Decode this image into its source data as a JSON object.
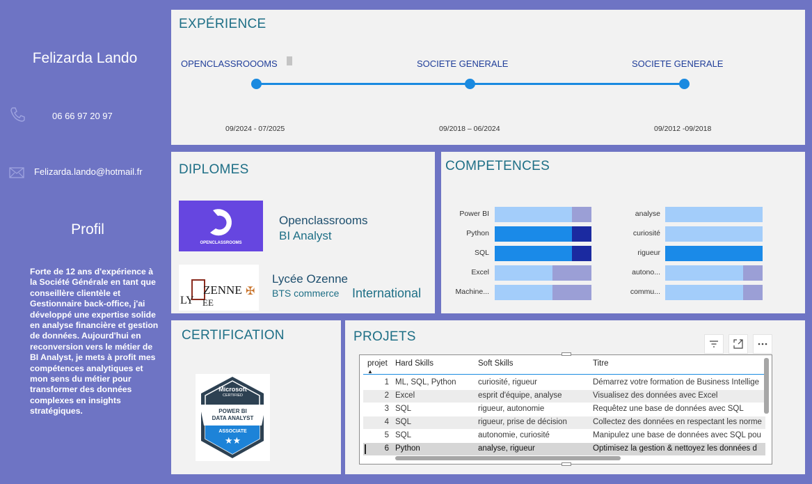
{
  "profile": {
    "name": "Felizarda Lando",
    "phone": "06 66 97 20 97",
    "email": "Felizarda.lando@hotmail.fr",
    "profil_title": "Profil",
    "profil_text": "Forte de 12 ans d'expérience à la Société Générale en  tant que conseillère clientèle et Gestionnaire back-office, j'ai développé une expertise solide en analyse financière et gestion de données. Aujourd'hui en reconversion vers le métier de BI Analyst, je mets à profit mes compétences analytiques et mon sens du métier pour transformer des données complexes en insights stratégiques."
  },
  "experience": {
    "title": "EXPÉRIENCE",
    "items": [
      {
        "company": "OPENCLASSROOOMS",
        "dates": "09/2024 - 07/2025"
      },
      {
        "company": "SOCIETE GENERALE",
        "dates": "09/2018 – 06/2024"
      },
      {
        "company": "SOCIETE GENERALE",
        "dates": "09/2012 -09/2018"
      }
    ]
  },
  "diplomes": {
    "title": "DIPLOMES",
    "items": [
      {
        "school": "Openclassrooms",
        "degree": "BI Analyst",
        "logo_text": "OPENCLASSROOMS"
      },
      {
        "school": "Lycée Ozenne",
        "degree_a": "BTS commerce",
        "degree_b": "International",
        "logo_text_a": "ZENNE",
        "logo_text_b": "LY",
        "logo_text_c": "EE"
      }
    ]
  },
  "competences": {
    "title": "COMPETENCES",
    "hard": [
      {
        "label": "Power BI",
        "level": 0.8,
        "colors": [
          "#a3cdfa",
          "#9b9fd6"
        ]
      },
      {
        "label": "Python",
        "level": 0.8,
        "colors": [
          "#1a8ae8",
          "#1b2aa0"
        ]
      },
      {
        "label": "SQL",
        "level": 0.8,
        "colors": [
          "#1a8ae8",
          "#1b2aa0"
        ]
      },
      {
        "label": "Excel",
        "level": 0.6,
        "colors": [
          "#a3cdfa",
          "#9b9fd6"
        ]
      },
      {
        "label": "Machine...",
        "level": 0.6,
        "colors": [
          "#a3cdfa",
          "#9b9fd6"
        ]
      }
    ],
    "soft": [
      {
        "label": "analyse",
        "level": 1.0,
        "colors": [
          "#a3cdfa",
          "#9b9fd6"
        ]
      },
      {
        "label": "curiosité",
        "level": 1.0,
        "colors": [
          "#a3cdfa",
          "#9b9fd6"
        ]
      },
      {
        "label": "rigueur",
        "level": 1.0,
        "colors": [
          "#1a8ae8",
          "#1b2aa0"
        ]
      },
      {
        "label": "autono...",
        "level": 0.8,
        "colors": [
          "#a3cdfa",
          "#9b9fd6"
        ]
      },
      {
        "label": "commu...",
        "level": 0.8,
        "colors": [
          "#a3cdfa",
          "#9b9fd6"
        ]
      }
    ]
  },
  "certification": {
    "title": "CERTIFICATION",
    "badge_brand": "Microsoft",
    "badge_sub": "CERTIFIED",
    "badge_line1": "POWER BI",
    "badge_line2": "DATA ANALYST",
    "badge_level": "ASSOCIATE",
    "badge_stars": "★★"
  },
  "projets": {
    "title": "PROJETS",
    "columns": [
      "projet",
      "Hard Skills",
      "Soft Skills",
      "Titre"
    ],
    "rows": [
      {
        "n": "1",
        "hard": "ML, SQL, Python",
        "soft": "curiosité, rigueur",
        "titre": "Démarrez votre formation de Business Intellige"
      },
      {
        "n": "2",
        "hard": "Excel",
        "soft": "esprit d'équipe, analyse",
        "titre": "Visualisez des données avec Excel"
      },
      {
        "n": "3",
        "hard": "SQL",
        "soft": "rigueur, autonomie",
        "titre": "Requêtez une base de données avec SQL"
      },
      {
        "n": "4",
        "hard": "SQL",
        "soft": "rigueur, prise de décision",
        "titre": "Collectez des données en respectant les norme"
      },
      {
        "n": "5",
        "hard": "SQL",
        "soft": "autonomie, curiosité",
        "titre": "Manipulez une base de données avec SQL pou"
      },
      {
        "n": "6",
        "hard": "Python",
        "soft": "analyse, rigueur",
        "titre": "Optimisez la gestion & nettoyez les données d"
      }
    ]
  },
  "icons": {
    "phone": "phone-icon",
    "email": "mail-icon",
    "filter": "filter-icon",
    "focus": "focus-mode-icon",
    "more": "more-options-icon"
  }
}
